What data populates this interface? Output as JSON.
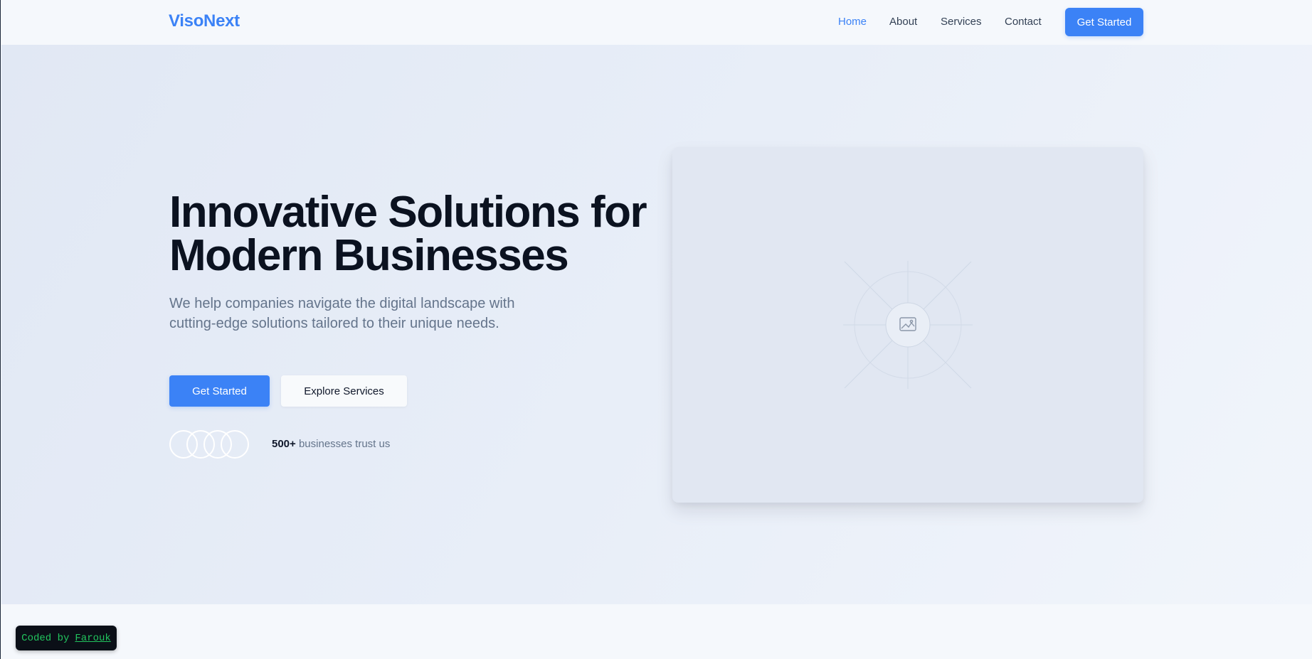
{
  "header": {
    "logo": "VisoNext",
    "nav": {
      "home": "Home",
      "about": "About",
      "services": "Services",
      "contact": "Contact"
    },
    "cta_label": "Get Started"
  },
  "hero": {
    "title_line1": "Innovative Solutions for",
    "title_line2": "Modern Businesses",
    "subtitle": "We help companies navigate the digital landscape with cutting-edge solutions tailored to their unique needs.",
    "primary_button": "Get Started",
    "secondary_button": "Explore Services",
    "trust_count": "500+",
    "trust_text": "businesses trust us",
    "image_icon": "image-icon"
  },
  "badge": {
    "prefix": "Coded by",
    "author": "Farouk"
  },
  "colors": {
    "accent": "#3b82f6",
    "title": "#0b1220",
    "muted": "#64748b",
    "badge_text": "#22c55e"
  }
}
